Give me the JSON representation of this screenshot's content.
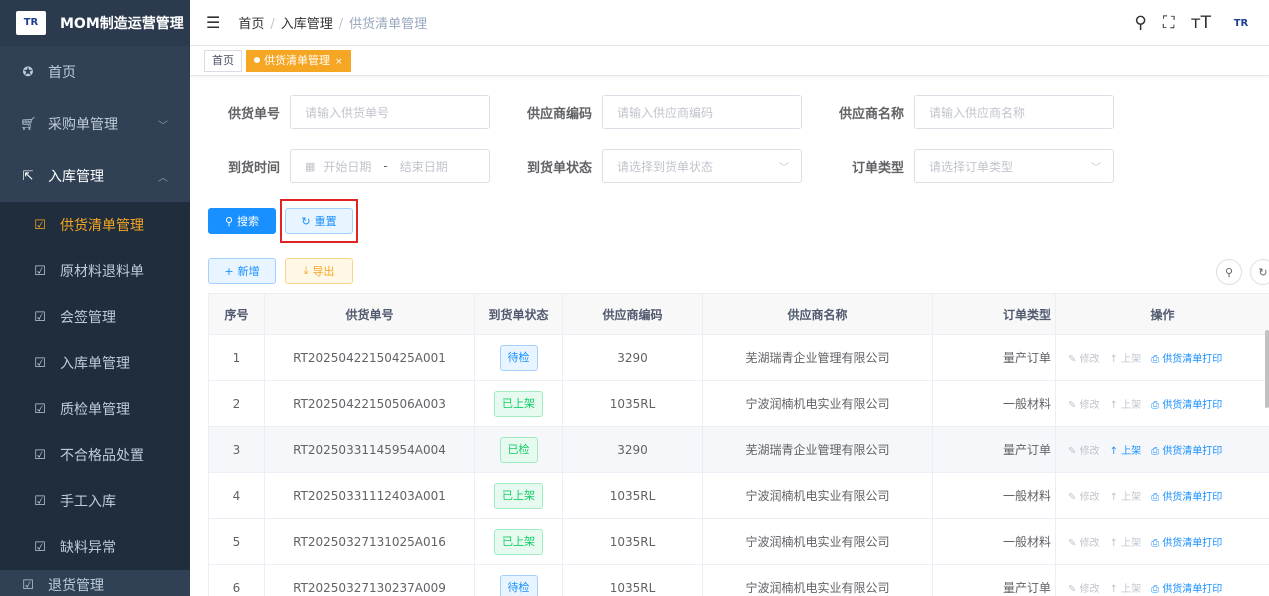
{
  "app": {
    "logo_text": "TR",
    "title": "MOM制造运营管理"
  },
  "sidebar": {
    "items": [
      {
        "label": "首页",
        "icon": "dashboard-icon"
      },
      {
        "label": "采购单管理",
        "icon": "cart-icon",
        "chevron": "﹀"
      },
      {
        "label": "入库管理",
        "icon": "external-link-icon",
        "chevron": "︿"
      }
    ],
    "sub_items": [
      {
        "label": "供货清单管理",
        "active": true
      },
      {
        "label": "原材料退料单"
      },
      {
        "label": "会签管理"
      },
      {
        "label": "入库单管理"
      },
      {
        "label": "质检单管理"
      },
      {
        "label": "不合格品处置"
      },
      {
        "label": "手工入库"
      },
      {
        "label": "缺料异常"
      }
    ],
    "cut_item": "退货管理"
  },
  "header": {
    "breadcrumb": [
      "首页",
      "入库管理",
      "供货清单管理"
    ],
    "brand": "TR"
  },
  "tags": {
    "home": "首页",
    "active": "供货清单管理",
    "close": "×"
  },
  "filters": {
    "supply_no_label": "供货单号",
    "supply_no_ph": "请输入供货单号",
    "vendor_code_label": "供应商编码",
    "vendor_code_ph": "请输入供应商编码",
    "vendor_name_label": "供应商名称",
    "vendor_name_ph": "请输入供应商名称",
    "arrival_time_label": "到货时间",
    "start_ph": "开始日期",
    "range_sep": "-",
    "end_ph": "结束日期",
    "arrival_status_label": "到货单状态",
    "arrival_status_ph": "请选择到货单状态",
    "order_type_label": "订单类型",
    "order_type_ph": "请选择订单类型"
  },
  "buttons": {
    "search": "搜索",
    "reset": "重置",
    "add": "新增",
    "export": "导出"
  },
  "table": {
    "headers": [
      "序号",
      "供货单号",
      "到货单状态",
      "供应商编码",
      "供应商名称",
      "订单类型",
      "操作"
    ],
    "ops": {
      "edit": "修改",
      "shelve": "上架",
      "print": "供货清单打印"
    },
    "rows": [
      {
        "no": "1",
        "supply_no": "RT20250422150425A001",
        "status": "待检",
        "status_kind": "pending",
        "vendor_code": "3290",
        "vendor_name": "芜湖瑞青企业管理有限公司",
        "order_type": "量产订单",
        "shelve_enabled": false
      },
      {
        "no": "2",
        "supply_no": "RT20250422150506A003",
        "status": "已上架",
        "status_kind": "shelved",
        "vendor_code": "1035RL",
        "vendor_name": "宁波润楠机电实业有限公司",
        "order_type": "一般材料",
        "shelve_enabled": false
      },
      {
        "no": "3",
        "supply_no": "RT20250331145954A004",
        "status": "已检",
        "status_kind": "checked",
        "vendor_code": "3290",
        "vendor_name": "芜湖瑞青企业管理有限公司",
        "order_type": "量产订单",
        "shelve_enabled": true
      },
      {
        "no": "4",
        "supply_no": "RT20250331112403A001",
        "status": "已上架",
        "status_kind": "shelved",
        "vendor_code": "1035RL",
        "vendor_name": "宁波润楠机电实业有限公司",
        "order_type": "一般材料",
        "shelve_enabled": false
      },
      {
        "no": "5",
        "supply_no": "RT20250327131025A016",
        "status": "已上架",
        "status_kind": "shelved",
        "vendor_code": "1035RL",
        "vendor_name": "宁波润楠机电实业有限公司",
        "order_type": "一般材料",
        "shelve_enabled": false
      },
      {
        "no": "6",
        "supply_no": "RT20250327130237A009",
        "status": "待检",
        "status_kind": "pending",
        "vendor_code": "1035RL",
        "vendor_name": "宁波润楠机电实业有限公司",
        "order_type": "量产订单",
        "shelve_enabled": false
      }
    ]
  }
}
